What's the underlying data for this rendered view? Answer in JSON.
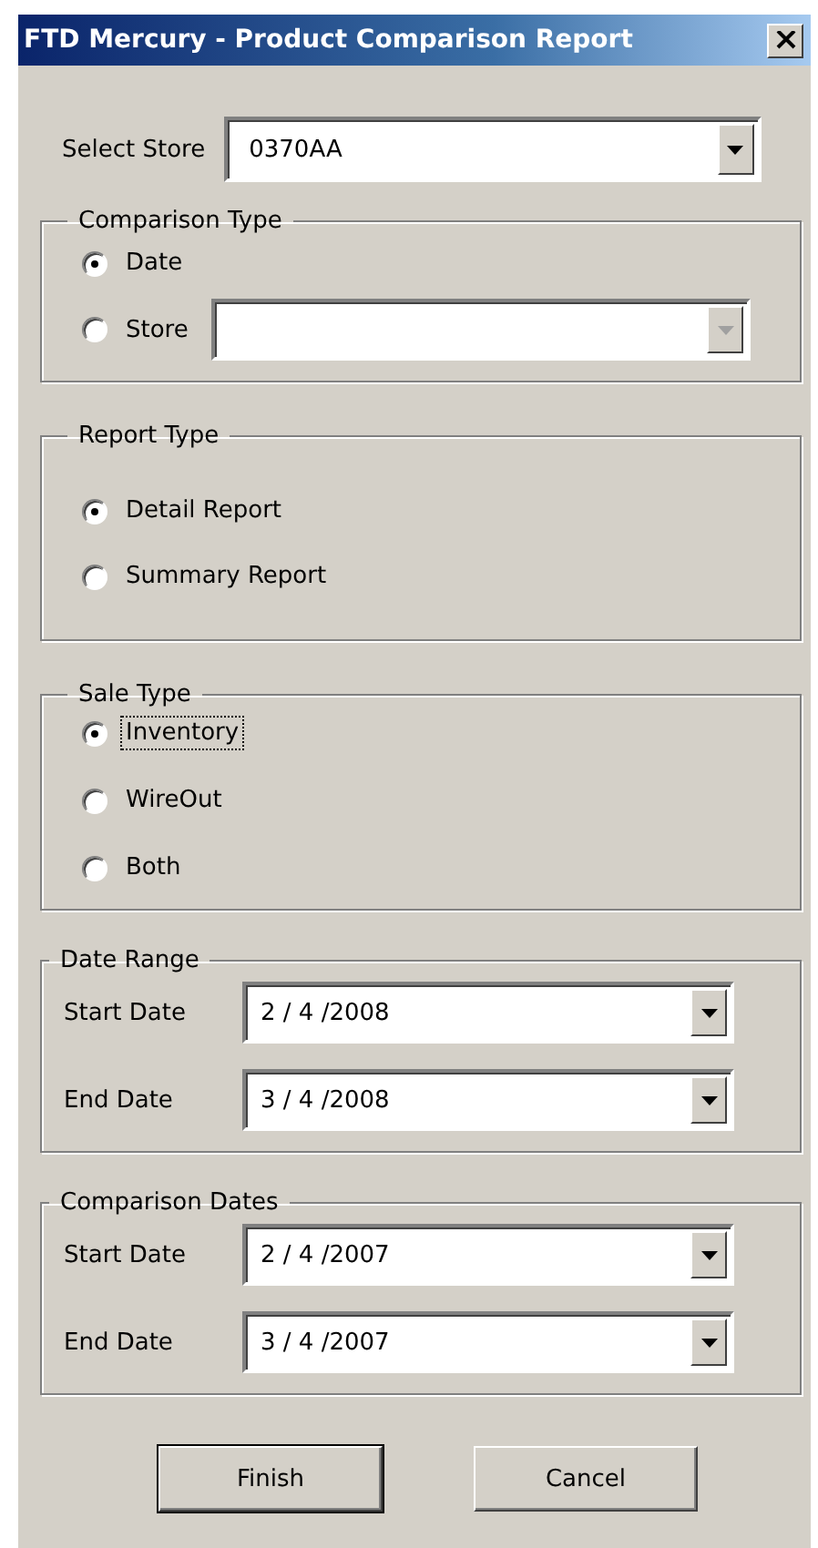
{
  "window": {
    "title": "FTD Mercury - Product Comparison Report"
  },
  "select_store": {
    "label": "Select Store",
    "value": "0370AA"
  },
  "comparison_type": {
    "title": "Comparison Type",
    "options": [
      {
        "label": "Date",
        "selected": true
      },
      {
        "label": "Store",
        "selected": false
      }
    ],
    "store_dropdown": {
      "disabled": true
    }
  },
  "report_type": {
    "title": "Report Type",
    "options": [
      {
        "label": "Detail Report",
        "selected": true
      },
      {
        "label": "Summary Report",
        "selected": false
      }
    ]
  },
  "sale_type": {
    "title": "Sale Type",
    "options": [
      {
        "label": "Inventory",
        "selected": true,
        "focused": true
      },
      {
        "label": "WireOut",
        "selected": false,
        "focused": false
      },
      {
        "label": "Both",
        "selected": false,
        "focused": false
      }
    ]
  },
  "date_range": {
    "title": "Date Range",
    "rows": [
      {
        "label": "Start Date",
        "value": "2 / 4 /2008"
      },
      {
        "label": "End Date",
        "value": "3 / 4 /2008"
      }
    ]
  },
  "comparison_dates": {
    "title": "Comparison Dates",
    "rows": [
      {
        "label": "Start Date",
        "value": "2 / 4 /2007"
      },
      {
        "label": "End Date",
        "value": "3 / 4 /2007"
      }
    ]
  },
  "buttons": [
    {
      "label": "Finish",
      "default": true
    },
    {
      "label": "Cancel",
      "default": false
    }
  ]
}
